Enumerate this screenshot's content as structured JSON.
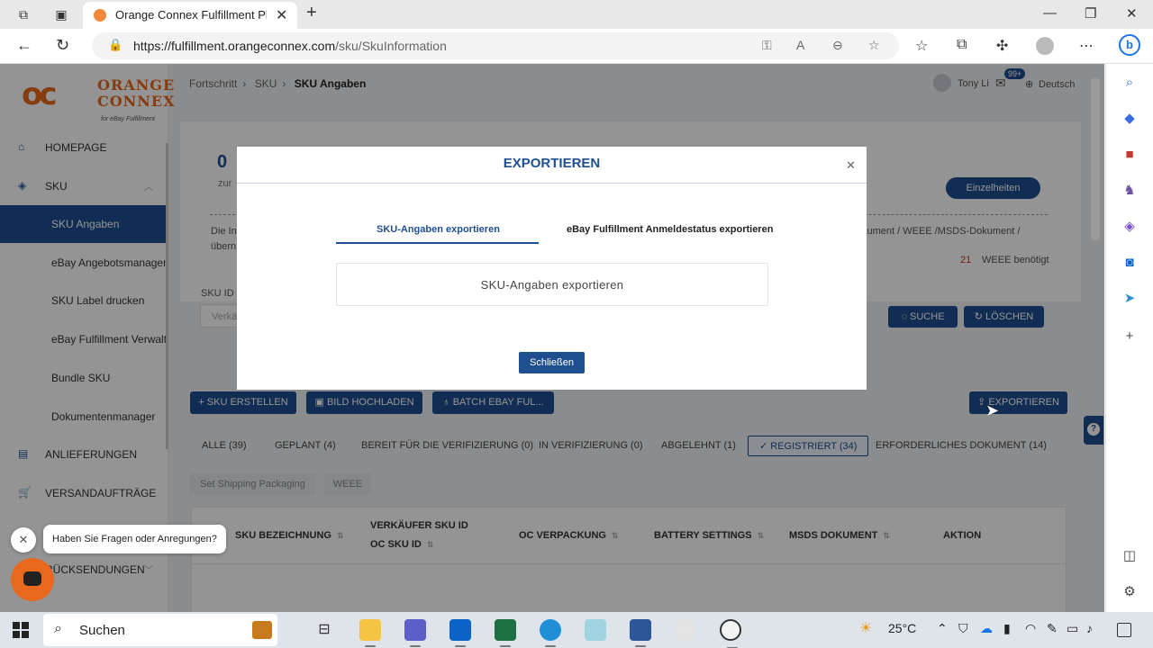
{
  "browser": {
    "tab_title": "Orange Connex Fulfillment Platform",
    "url_host": "https://fulfillment.orangeconnex.com",
    "url_path": "/sku/SkuInformation"
  },
  "sidebar": {
    "logo_line1": "ORANGE",
    "logo_line2": "CONNEX",
    "logo_sub": "for eBay Fulfillment",
    "items": [
      {
        "label": "HOMEPAGE"
      },
      {
        "label": "SKU"
      },
      {
        "label": "SKU Angaben"
      },
      {
        "label": "eBay Angebotsmanagement"
      },
      {
        "label": "SKU Label drucken"
      },
      {
        "label": "eBay Fulfillment Verwaltung"
      },
      {
        "label": "Bundle SKU"
      },
      {
        "label": "Dokumentenmanager"
      },
      {
        "label": "ANLIEFERUNGEN"
      },
      {
        "label": "VERSANDAUFTRÄGE"
      },
      {
        "label": "RÜCKSENDUNGEN"
      }
    ]
  },
  "header": {
    "breadcrumb": [
      "Fortschritt",
      "SKU",
      "SKU Angaben"
    ],
    "user_name": "Tony Li",
    "mail_badge": "99+",
    "language": "Deutsch"
  },
  "summary": {
    "count": "0",
    "count_label": "zur",
    "details_button": "Einzelheiten",
    "info_left_1": "Die In",
    "info_left_2": "übern",
    "info_right": "kument / WEEE /MSDS-Dokument /",
    "weee_count": "21",
    "weee_label": "WEEE benötigt"
  },
  "filters": {
    "sku_id_label": "SKU ID",
    "seller_placeholder": "Verkä",
    "search_button": "SUCHE",
    "clear_button": "LÖSCHEN"
  },
  "actions": {
    "create": "SKU ERSTELLEN",
    "upload": "BILD HOCHLADEN",
    "batch": "BATCH EBAY FUL...",
    "export": "EXPORTIEREN"
  },
  "status_tabs": [
    {
      "label": "ALLE (39)"
    },
    {
      "label": "GEPLANT (4)"
    },
    {
      "label": "BEREIT FÜR DIE VERIFIZIERUNG (0)"
    },
    {
      "label": "IN VERIFIZIERUNG (0)"
    },
    {
      "label": "ABGELEHNT (1)"
    },
    {
      "label": "REGISTRIERT (34)"
    },
    {
      "label": "ERFORDERLICHES DOKUMENT (14)"
    }
  ],
  "bulk_buttons": {
    "packaging": "Set Shipping Packaging",
    "weee": "WEEE"
  },
  "table": {
    "columns": {
      "name": "SKU BEZEICHNUNG",
      "seller_sku": "VERKÄUFER SKU ID",
      "oc_sku": "OC SKU ID",
      "packaging": "OC VERPACKUNG",
      "battery": "BATTERY SETTINGS",
      "msds": "MSDS DOKUMENT",
      "action": "AKTION"
    }
  },
  "chat": {
    "prompt": "Haben Sie Fragen oder Anregungen?"
  },
  "modal": {
    "title": "EXPORTIEREN",
    "tab_active": "SKU-Angaben exportieren",
    "tab_other": "eBay Fulfillment Anmeldestatus exportieren",
    "option": "SKU-Angaben exportieren",
    "close_button": "Schließen"
  },
  "taskbar": {
    "search": "Suchen",
    "weather": "25°C"
  },
  "colors": {
    "brand_orange": "#e8681d",
    "primary_blue": "#1f4f8f"
  }
}
